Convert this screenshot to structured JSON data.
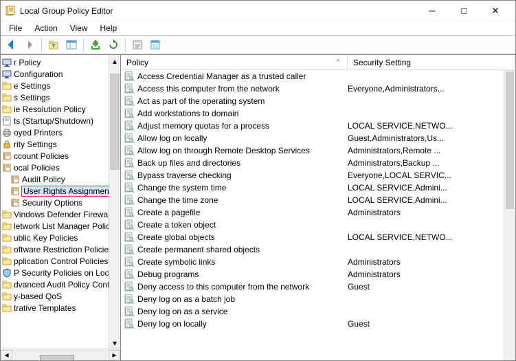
{
  "window": {
    "title": "Local Group Policy Editor"
  },
  "menu": {
    "file": "File",
    "action": "Action",
    "view": "View",
    "help": "Help"
  },
  "tree": {
    "items": [
      {
        "label": "r Policy",
        "indent": 0,
        "icon": "computer"
      },
      {
        "label": "Configuration",
        "indent": 0,
        "icon": "computer"
      },
      {
        "label": "e Settings",
        "indent": 0,
        "icon": "folder"
      },
      {
        "label": "s Settings",
        "indent": 0,
        "icon": "folder"
      },
      {
        "label": "ie Resolution Policy",
        "indent": 0,
        "icon": "folder"
      },
      {
        "label": "ts (Startup/Shutdown)",
        "indent": 0,
        "icon": "script"
      },
      {
        "label": "oyed Printers",
        "indent": 0,
        "icon": "printer"
      },
      {
        "label": "rity Settings",
        "indent": 0,
        "icon": "lock"
      },
      {
        "label": "ccount Policies",
        "indent": 0,
        "icon": "book"
      },
      {
        "label": "ocal Policies",
        "indent": 0,
        "icon": "book"
      },
      {
        "label": "Audit Policy",
        "indent": 1,
        "icon": "book"
      },
      {
        "label": "User Rights Assignment",
        "indent": 1,
        "icon": "book",
        "selected": true
      },
      {
        "label": "Security Options",
        "indent": 1,
        "icon": "book"
      },
      {
        "label": "Vindows Defender Firewall w",
        "indent": 0,
        "icon": "folder"
      },
      {
        "label": "letwork List Manager Policie:",
        "indent": 0,
        "icon": "folder"
      },
      {
        "label": "ublic Key Policies",
        "indent": 0,
        "icon": "folder"
      },
      {
        "label": "oftware Restriction Policies",
        "indent": 0,
        "icon": "folder"
      },
      {
        "label": "pplication Control Policies",
        "indent": 0,
        "icon": "folder"
      },
      {
        "label": "P Security Policies on Local C",
        "indent": 0,
        "icon": "shield"
      },
      {
        "label": "dvanced Audit Policy Confi(",
        "indent": 0,
        "icon": "folder"
      },
      {
        "label": "y-based QoS",
        "indent": 0,
        "icon": "folder"
      },
      {
        "label": "trative Templates",
        "indent": 0,
        "icon": "folder"
      }
    ]
  },
  "columns": {
    "policy": "Policy",
    "security": "Security Setting"
  },
  "policies": [
    {
      "name": "Access Credential Manager as a trusted caller",
      "setting": ""
    },
    {
      "name": "Access this computer from the network",
      "setting": "Everyone,Administrators..."
    },
    {
      "name": "Act as part of the operating system",
      "setting": ""
    },
    {
      "name": "Add workstations to domain",
      "setting": ""
    },
    {
      "name": "Adjust memory quotas for a process",
      "setting": "LOCAL SERVICE,NETWO..."
    },
    {
      "name": "Allow log on locally",
      "setting": "Guest,Administrators,Us..."
    },
    {
      "name": "Allow log on through Remote Desktop Services",
      "setting": "Administrators,Remote ..."
    },
    {
      "name": "Back up files and directories",
      "setting": "Administrators,Backup ..."
    },
    {
      "name": "Bypass traverse checking",
      "setting": "Everyone,LOCAL SERVIC..."
    },
    {
      "name": "Change the system time",
      "setting": "LOCAL SERVICE,Admini..."
    },
    {
      "name": "Change the time zone",
      "setting": "LOCAL SERVICE,Admini..."
    },
    {
      "name": "Create a pagefile",
      "setting": "Administrators"
    },
    {
      "name": "Create a token object",
      "setting": ""
    },
    {
      "name": "Create global objects",
      "setting": "LOCAL SERVICE,NETWO..."
    },
    {
      "name": "Create permanent shared objects",
      "setting": ""
    },
    {
      "name": "Create symbolic links",
      "setting": "Administrators"
    },
    {
      "name": "Debug programs",
      "setting": "Administrators"
    },
    {
      "name": "Deny access to this computer from the network",
      "setting": "Guest"
    },
    {
      "name": "Deny log on as a batch job",
      "setting": ""
    },
    {
      "name": "Deny log on as a service",
      "setting": ""
    },
    {
      "name": "Deny log on locally",
      "setting": "Guest"
    }
  ]
}
